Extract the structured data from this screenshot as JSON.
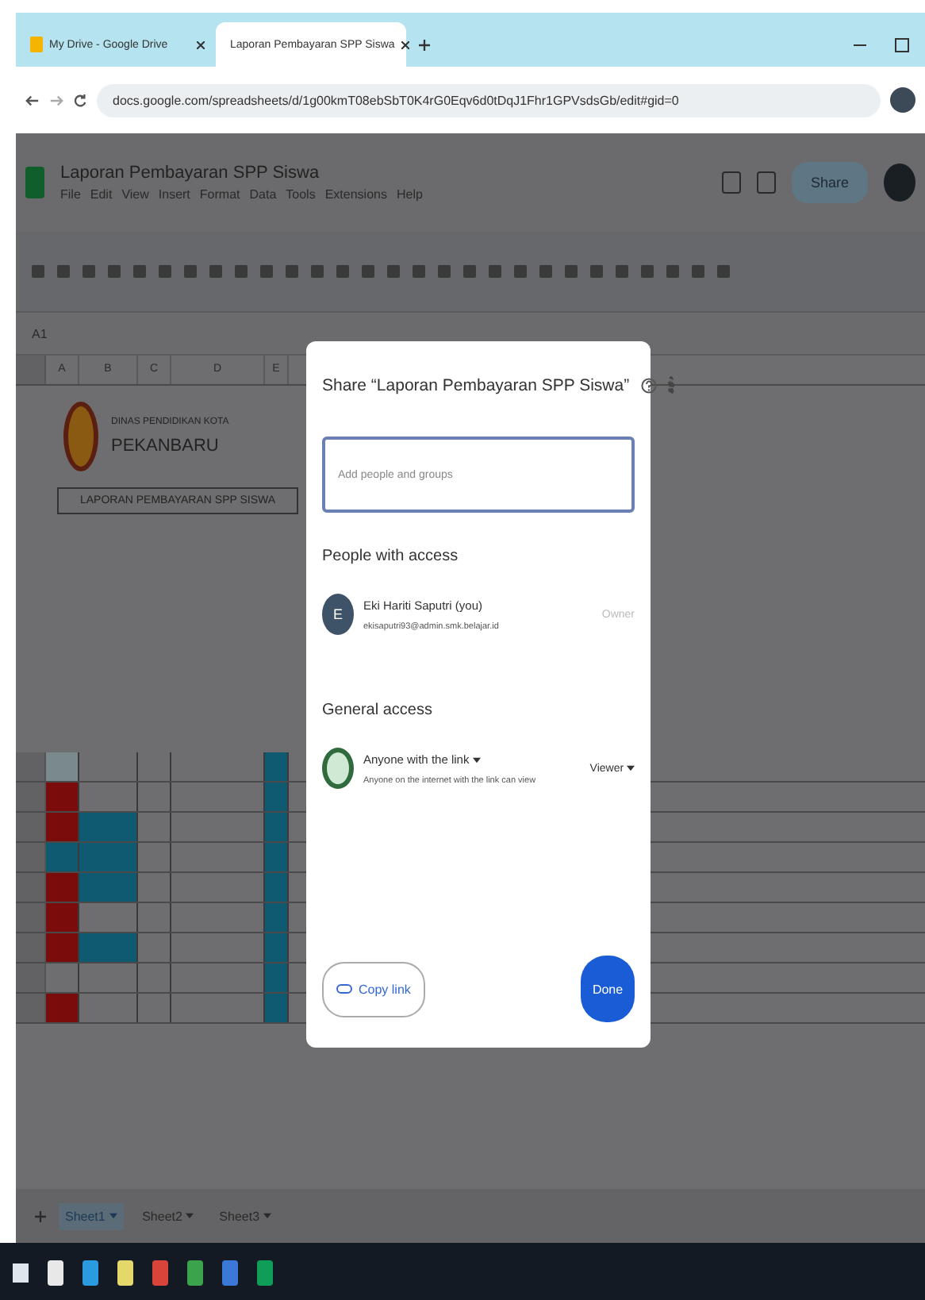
{
  "browser": {
    "tabs": [
      {
        "title": "My Drive - Google Drive",
        "selected": false
      },
      {
        "title": "Laporan Pembayaran SPP Siswa",
        "selected": true
      }
    ],
    "url": "docs.google.com/spreadsheets/d/1g00kmT08ebSbT0K4rG0Eqv6d0tDqJ1Fhr1GPVsdsGb/edit#gid=0"
  },
  "app": {
    "doc_title": "Laporan Pembayaran SPP Siswa",
    "menu": [
      "File",
      "Edit",
      "View",
      "Insert",
      "Format",
      "Data",
      "Tools",
      "Extensions",
      "Help"
    ],
    "share_label": "Share",
    "cell_ref": "A1"
  },
  "sheet": {
    "columns": [
      "A",
      "B",
      "C",
      "D",
      "E"
    ],
    "org_line": "DINAS PENDIDIKAN KOTA",
    "city": "PEKANBARU",
    "report_title": "LAPORAN PEMBAYARAN SPP SISWA",
    "rows": [
      {
        "cells": [
          {
            "color": "#7a8a8c"
          },
          {},
          {},
          {},
          {
            "color": "#0f5a70"
          }
        ]
      },
      {
        "cells": [
          {
            "color": "#7a0c0c"
          },
          {},
          {},
          {},
          {
            "color": "#0f5a70"
          }
        ]
      },
      {
        "cells": [
          {
            "color": "#7a0c0c"
          },
          {
            "color": "#0f5a70"
          },
          {},
          {},
          {
            "color": "#0f5a70"
          }
        ]
      },
      {
        "cells": [
          {
            "color": "#0f5a70"
          },
          {
            "color": "#0f5a70"
          },
          {},
          {},
          {
            "color": "#0f5a70"
          }
        ]
      },
      {
        "cells": [
          {
            "color": "#7a0c0c"
          },
          {
            "color": "#0f5a70"
          },
          {},
          {},
          {
            "color": "#0f5a70"
          }
        ]
      },
      {
        "cells": [
          {
            "color": "#7a0c0c"
          },
          {},
          {},
          {},
          {
            "color": "#0f5a70"
          }
        ]
      },
      {
        "cells": [
          {
            "color": "#7a0c0c"
          },
          {
            "color": "#0f5a70"
          },
          {},
          {},
          {
            "color": "#0f5a70"
          }
        ]
      },
      {
        "cells": [
          {},
          {},
          {},
          {},
          {
            "color": "#0f5a70"
          }
        ]
      },
      {
        "cells": [
          {
            "color": "#7a0c0c"
          },
          {},
          {},
          {},
          {
            "color": "#0f5a70"
          }
        ]
      }
    ],
    "sheet_tabs": [
      {
        "label": "Sheet1",
        "selected": true
      },
      {
        "label": "Sheet2",
        "selected": false
      },
      {
        "label": "Sheet3",
        "selected": false
      }
    ]
  },
  "dialog": {
    "title": "Share “Laporan Pembayaran SPP Siswa”",
    "add_field": {
      "placeholder": "Add people and groups"
    },
    "people_heading": "People with access",
    "people": [
      {
        "initial": "E",
        "name": "Eki Hariti Saputri (you)",
        "email": "ekisaputri93@admin.smk.belajar.id",
        "role": "Owner"
      }
    ],
    "general_heading": "General access",
    "access": {
      "label": "Anyone with the link",
      "description": "Anyone on the internet with the link can view",
      "role": "Viewer"
    },
    "copy_link": "Copy link",
    "done": "Done"
  }
}
